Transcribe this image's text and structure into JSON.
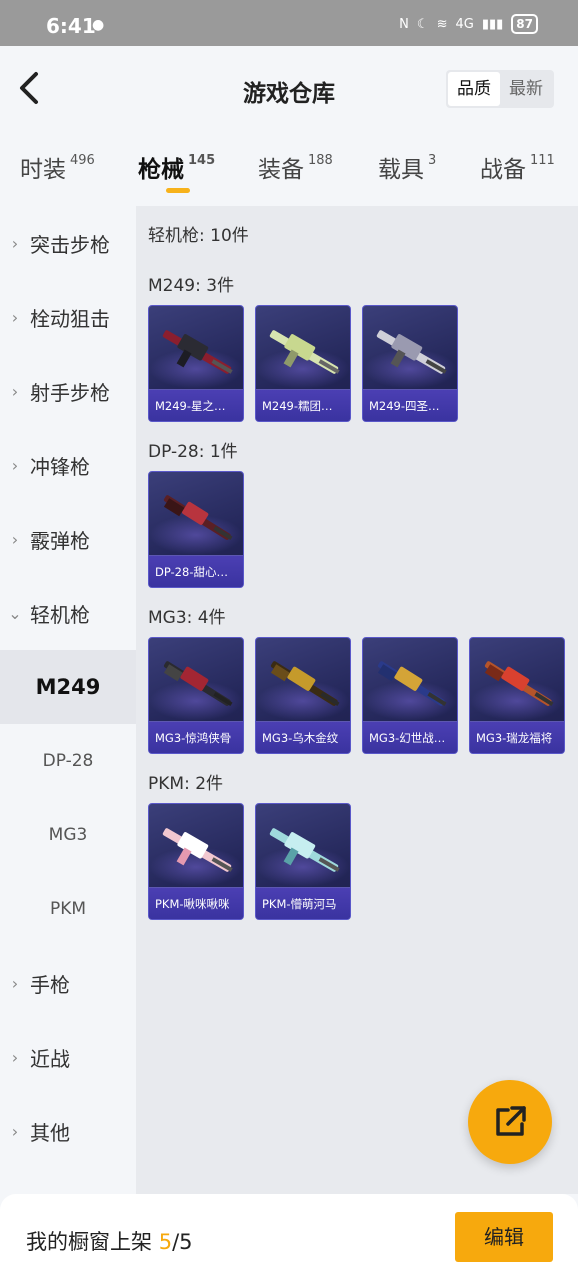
{
  "status_bar": {
    "time": "6:41",
    "battery": "87",
    "network": "4G",
    "chat_icon": "wechat-icon"
  },
  "header": {
    "title": "游戏仓库",
    "sort_quality": "品质",
    "sort_newest": "最新",
    "back_icon": "chevron-left-icon"
  },
  "tabs": [
    {
      "label": "时装",
      "count": "496"
    },
    {
      "label": "枪械",
      "count": "145"
    },
    {
      "label": "装备",
      "count": "188"
    },
    {
      "label": "载具",
      "count": "3"
    },
    {
      "label": "战备",
      "count": "111"
    }
  ],
  "sidebar": {
    "items": [
      "突击步枪",
      "栓动狙击",
      "射手步枪",
      "冲锋枪",
      "霰弹枪",
      "轻机枪",
      "M249",
      "DP-28",
      "MG3",
      "PKM",
      "手枪",
      "近战",
      "其他"
    ]
  },
  "content": {
    "total": "轻机枪: 10件",
    "groups": [
      {
        "title": "M249: 3件",
        "items": [
          "M249-星之…",
          "M249-糯团…",
          "M249-四圣…"
        ]
      },
      {
        "title": "DP-28: 1件",
        "items": [
          "DP-28-甜心…"
        ]
      },
      {
        "title": "MG3: 4件",
        "items": [
          "MG3-惊鸿侠骨",
          "MG3-乌木金纹",
          "MG3-幻世战…",
          "MG3-瑞龙福将"
        ]
      },
      {
        "title": "PKM: 2件",
        "items": [
          "PKM-啾咪啾咪",
          "PKM-懵萌河马"
        ]
      }
    ]
  },
  "bottom": {
    "label": "我的橱窗上架 ",
    "current": "5",
    "total": "/5",
    "edit": "编辑"
  },
  "colors": {
    "accent": "#f7a90d",
    "card_bg": "#24275a",
    "card_label": "#4b3fb3"
  }
}
